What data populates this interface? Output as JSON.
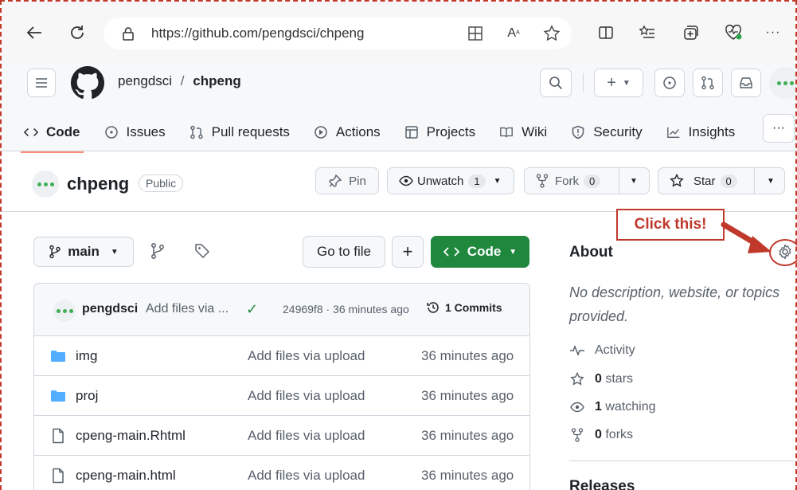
{
  "browser": {
    "url": "https://github.com/pengdsci/chpeng",
    "more_label": "···"
  },
  "header": {
    "owner": "pengdsci",
    "separator": "/",
    "repo": "chpeng",
    "plus_label": "+"
  },
  "tabs": [
    {
      "label": "Code",
      "icon": "code-icon"
    },
    {
      "label": "Issues",
      "icon": "issue-icon"
    },
    {
      "label": "Pull requests",
      "icon": "pull-request-icon"
    },
    {
      "label": "Actions",
      "icon": "play-icon"
    },
    {
      "label": "Projects",
      "icon": "table-icon"
    },
    {
      "label": "Wiki",
      "icon": "book-icon"
    },
    {
      "label": "Security",
      "icon": "shield-icon"
    },
    {
      "label": "Insights",
      "icon": "graph-icon"
    }
  ],
  "repo": {
    "name": "chpeng",
    "visibility": "Public",
    "pin_label": "Pin",
    "unwatch_label": "Unwatch",
    "unwatch_count": "1",
    "fork_label": "Fork",
    "fork_count": "0",
    "star_label": "Star",
    "star_count": "0"
  },
  "filebar": {
    "branch": "main",
    "go_to_file": "Go to file",
    "add_label": "+",
    "code_label": "Code"
  },
  "commit": {
    "author": "pengdsci",
    "message": "Add files via ...",
    "check": "✓",
    "hash_time": "24969f8 · 36 minutes ago",
    "commits_label": "1 Commits"
  },
  "files": [
    {
      "name": "img",
      "type": "folder",
      "message": "Add files via upload",
      "time": "36 minutes ago"
    },
    {
      "name": "proj",
      "type": "folder",
      "message": "Add files via upload",
      "time": "36 minutes ago"
    },
    {
      "name": "cpeng-main.Rhtml",
      "type": "file",
      "message": "Add files via upload",
      "time": "36 minutes ago"
    },
    {
      "name": "cpeng-main.html",
      "type": "file",
      "message": "Add files via upload",
      "time": "36 minutes ago"
    }
  ],
  "about": {
    "title": "About",
    "description": "No description, website, or topics provided.",
    "activity": "Activity",
    "stars_count": "0",
    "stars_label": "stars",
    "watching_count": "1",
    "watching_label": "watching",
    "forks_count": "0",
    "forks_label": "forks",
    "releases": "Releases"
  },
  "annotation": {
    "callout": "Click this!",
    "color": "#c0392b"
  },
  "colors": {
    "green": "#1f883d",
    "avatar": "#3fae56",
    "tab_underline": "#fd8c73",
    "folder": "#54aeff"
  }
}
